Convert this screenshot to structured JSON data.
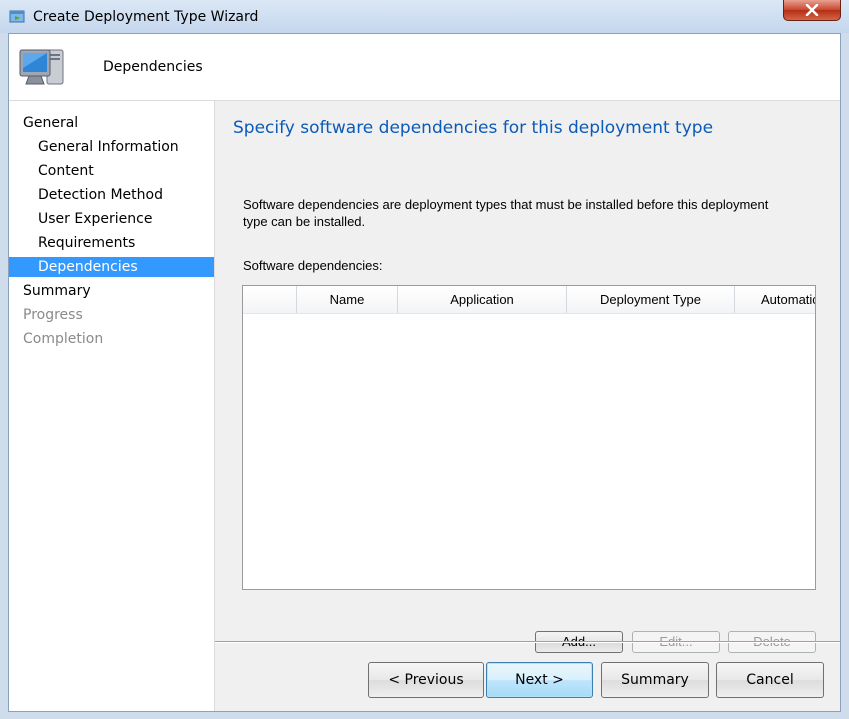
{
  "window": {
    "title": "Create Deployment Type Wizard",
    "title_icon": "wizard-icon",
    "close_icon": "close-icon"
  },
  "header": {
    "icon": "computer-icon",
    "title": "Dependencies"
  },
  "sidebar": {
    "items": [
      {
        "label": "General",
        "level": "top",
        "state": "normal"
      },
      {
        "label": "General Information",
        "level": "sub",
        "state": "normal"
      },
      {
        "label": "Content",
        "level": "sub",
        "state": "normal"
      },
      {
        "label": "Detection Method",
        "level": "sub",
        "state": "normal"
      },
      {
        "label": "User Experience",
        "level": "sub",
        "state": "normal"
      },
      {
        "label": "Requirements",
        "level": "sub",
        "state": "normal"
      },
      {
        "label": "Dependencies",
        "level": "sub",
        "state": "active"
      },
      {
        "label": "Summary",
        "level": "top",
        "state": "normal"
      },
      {
        "label": "Progress",
        "level": "top",
        "state": "disabled"
      },
      {
        "label": "Completion",
        "level": "top",
        "state": "disabled"
      }
    ]
  },
  "main": {
    "heading": "Specify software dependencies for this deployment type",
    "description": "Software dependencies are deployment types that must be installed before this deployment type can be installed.",
    "list_label": "Software dependencies:",
    "columns": [
      "",
      "Name",
      "Application",
      "Deployment Type",
      "Automatic"
    ],
    "rows": [],
    "buttons": {
      "add": "Add...",
      "edit": "Edit...",
      "delete": "Delete"
    }
  },
  "footer": {
    "previous": "< Previous",
    "next": "Next >",
    "summary": "Summary",
    "cancel": "Cancel"
  },
  "colors": {
    "accent": "#3399ff",
    "heading": "#0b5ab8",
    "close": "#c9452c"
  }
}
